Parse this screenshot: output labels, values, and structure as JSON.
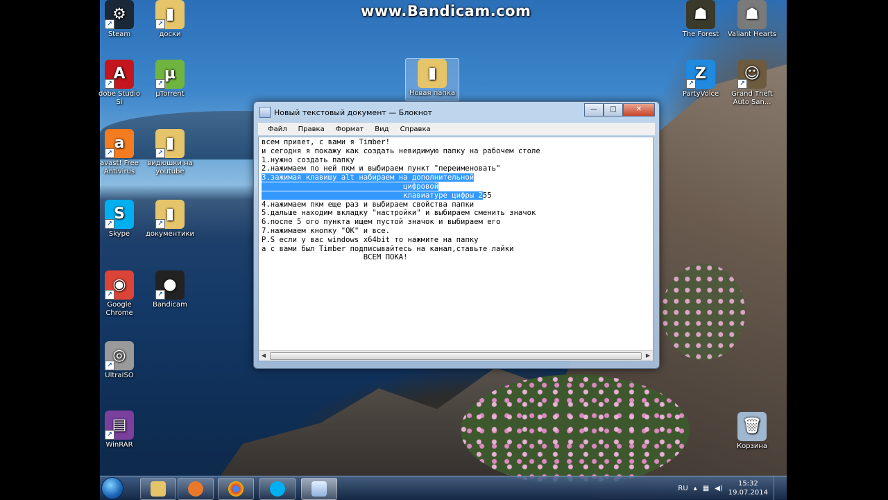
{
  "watermark": "www.Bandicam.com",
  "desktop_icons": [
    {
      "id": "steam",
      "label": "Steam",
      "color": "#1b2838",
      "glyph": "⚙"
    },
    {
      "id": "doski",
      "label": "доски",
      "color": "#e6c46a",
      "glyph": "▮"
    },
    {
      "id": "the-forest",
      "label": "The Forest",
      "color": "#3a3a2a",
      "glyph": "☗"
    },
    {
      "id": "valiant-hearts",
      "label": "Valiant Hearts",
      "color": "#7a7a7a",
      "glyph": "☗"
    },
    {
      "id": "adobe",
      "label": "dobe Studio\nSi",
      "color": "#c4161c",
      "glyph": "A"
    },
    {
      "id": "utorrent",
      "label": "µTorrent",
      "color": "#6fb43f",
      "glyph": "µ"
    },
    {
      "id": "partyvoice",
      "label": "PartyVoice",
      "color": "#1f8ae0",
      "glyph": "Z"
    },
    {
      "id": "gta",
      "label": "Grand Theft\nAuto San...",
      "color": "#6d5a3f",
      "glyph": "☺"
    },
    {
      "id": "avast",
      "label": "avast! Free\nAntivirus",
      "color": "#f47b20",
      "glyph": "a"
    },
    {
      "id": "videos",
      "label": "видюшки на\nyoutube",
      "color": "#e6c46a",
      "glyph": "▮"
    },
    {
      "id": "skype",
      "label": "Skype",
      "color": "#00aff0",
      "glyph": "S"
    },
    {
      "id": "documents",
      "label": "документики",
      "color": "#e6c46a",
      "glyph": "▮"
    },
    {
      "id": "chrome",
      "label": "Google\nChrome",
      "color": "#db4437",
      "glyph": "◉"
    },
    {
      "id": "bandicam",
      "label": "Bandicam",
      "color": "#222",
      "glyph": "●"
    },
    {
      "id": "ultraiso",
      "label": "UltraISO",
      "color": "#9a9a9a",
      "glyph": "◎"
    },
    {
      "id": "winrar",
      "label": "WinRAR",
      "color": "#7b3f9e",
      "glyph": "▤"
    },
    {
      "id": "new-folder",
      "label": "Новая папка",
      "color": "#e6c46a",
      "glyph": "▮"
    },
    {
      "id": "recycle-bin",
      "label": "Корзина",
      "color": "#9fb7cf",
      "glyph": "🗑"
    }
  ],
  "notepad": {
    "title": "Новый текстовый документ — Блокнот",
    "menu": [
      "Файл",
      "Правка",
      "Формат",
      "Вид",
      "Справка"
    ],
    "lines": [
      "всем привет, с вами я Timber!",
      "и сегодня я покажу как создать невидимую папку на рабочем столе",
      "1.нужно создать папку",
      "2.нажимаем по ней пкм и выбираем пункт \"переименовать\""
    ],
    "selected": {
      "line1": "3.зажимая клавишу alt набираем на дополнительной",
      "line2": "                                цифровой",
      "line3": "                                клавиатуре цифры 2",
      "after": "55"
    },
    "lines_after": [
      "4.нажимаем пкм еще раз и выбираем свойства папки",
      "5.дальше находим вкладку \"настройки\" и выбираем сменить значок",
      "6.после 5 ого пункта ищем пустой значок и выбираем его",
      "7.нажимаем кнопку \"ОК\" и все.",
      "P.S если у вас windows x64bit то нажмите на папку",
      "а с вами был Timber подписывайтесь на канал,ставьте лайки",
      "                       ВСЕМ ПОКА!"
    ]
  },
  "taskbar": {
    "language": "RU",
    "time": "15:32",
    "date": "19.07.2014"
  }
}
